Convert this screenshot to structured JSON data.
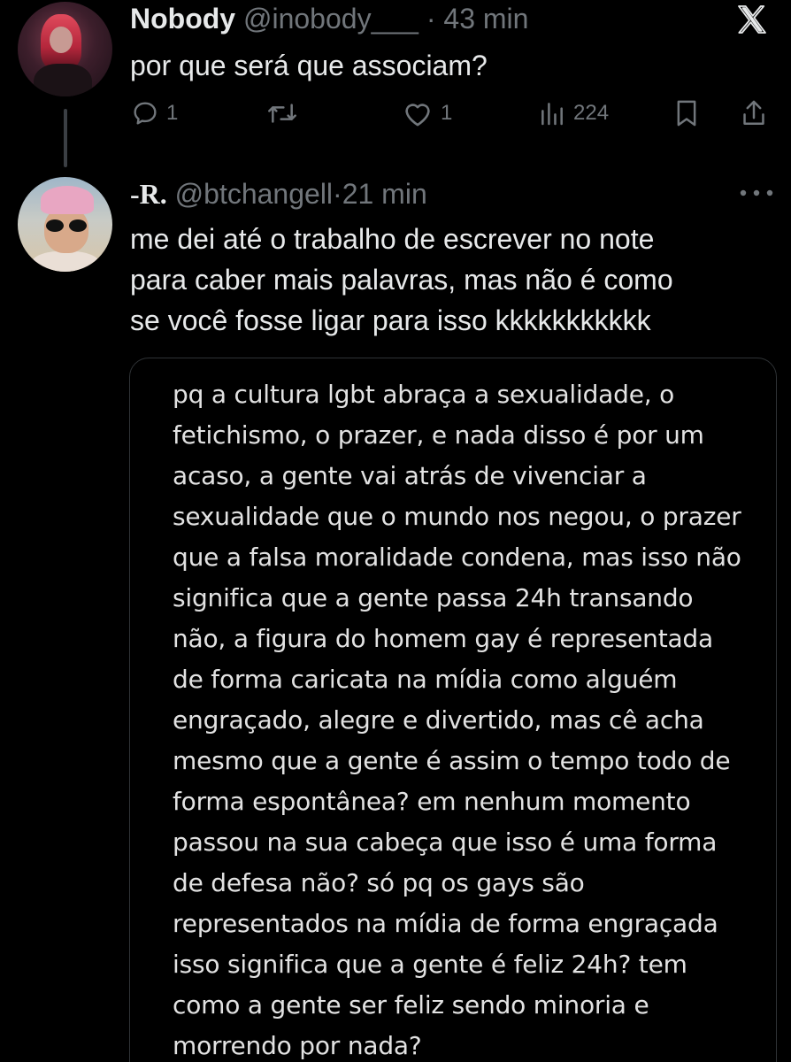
{
  "tweet1": {
    "name": "Nobody",
    "handle": "@inobody___",
    "separator": "·",
    "time": "43 min",
    "text": "por que será que associam?",
    "actions": {
      "replies": "1",
      "retweets": "",
      "likes": "1",
      "views": "224"
    }
  },
  "tweet2": {
    "name": "-R.",
    "handle": "@btchangell",
    "separator": "·",
    "time": "21 min",
    "text_lines": [
      "me dei até o trabalho de escrever no note",
      "para caber mais palavras, mas não é como",
      "se você fosse ligar para isso kkkkkkkkkkk"
    ],
    "note_lines": [
      "pq a cultura lgbt abraça a sexualidade, o",
      "fetichismo, o prazer, e nada disso é por um",
      "acaso, a gente vai atrás de vivenciar a",
      "sexualidade que o mundo nos negou, o prazer",
      "que a falsa moralidade condena, mas isso não",
      "significa que a gente passa 24h transando",
      "não, a figura do homem gay é representada",
      "de forma caricata na mídia como alguém",
      "engraçado, alegre e divertido, mas cê acha",
      "mesmo que a gente é assim o tempo todo de",
      "forma espontânea? em nenhum momento",
      "passou na sua cabeça que isso é uma forma",
      "de defesa não? só pq os gays são",
      "representados na mídia de forma engraçada",
      "isso significa que a gente é feliz 24h? tem",
      "como a gente ser feliz sendo minoria e",
      "morrendo por nada?"
    ]
  },
  "icons": {
    "brand": "x-logo-icon",
    "reply": "reply-icon",
    "retweet": "retweet-icon",
    "like": "heart-icon",
    "views": "views-icon",
    "bookmark": "bookmark-icon",
    "share": "share-icon",
    "more": "more-icon"
  },
  "colors": {
    "background": "#000000",
    "primary_text": "#e7e9ea",
    "secondary_text": "#71767b",
    "border": "#2f3336"
  }
}
